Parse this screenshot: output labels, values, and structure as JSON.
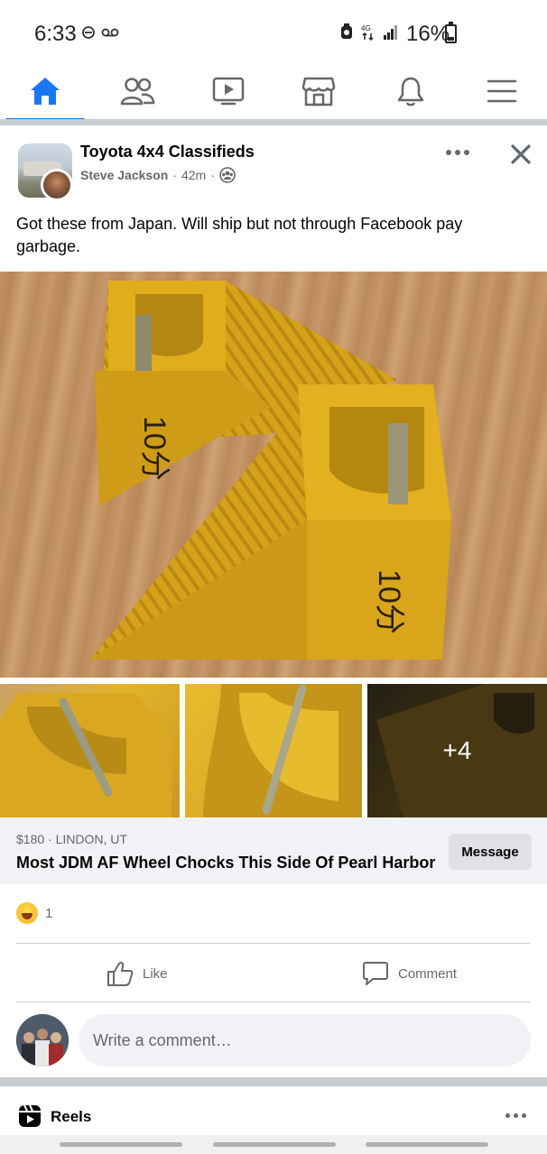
{
  "status_bar": {
    "time": "6:33",
    "battery": "16%"
  },
  "nav": {
    "items": [
      {
        "name": "home",
        "icon": "home-icon",
        "active": true
      },
      {
        "name": "friends",
        "icon": "friends-icon",
        "active": false
      },
      {
        "name": "video",
        "icon": "video-icon",
        "active": false
      },
      {
        "name": "marketplace",
        "icon": "marketplace-icon",
        "active": false
      },
      {
        "name": "notifications",
        "icon": "bell-icon",
        "active": false
      },
      {
        "name": "menu",
        "icon": "menu-icon",
        "active": false
      }
    ],
    "accent_color": "#1877f2"
  },
  "post": {
    "group_name": "Toyota 4x4 Classifieds",
    "author": "Steve Jackson",
    "separator": "·",
    "time": "42m",
    "audience_icon": "group-icon",
    "text": "Got these from Japan. Will ship but not through Facebook pay garbage.",
    "more_photos": "+4"
  },
  "listing": {
    "price_location": "$180 · LINDON, UT",
    "title": "Most JDM AF Wheel Chocks This Side Of Pearl Harbor",
    "message_label": "Message"
  },
  "reactions": {
    "icon": "haha-icon",
    "count": "1"
  },
  "actions": {
    "like_label": "Like",
    "comment_label": "Comment"
  },
  "comment_box": {
    "placeholder": "Write a comment…"
  },
  "reels": {
    "label": "Reels"
  }
}
